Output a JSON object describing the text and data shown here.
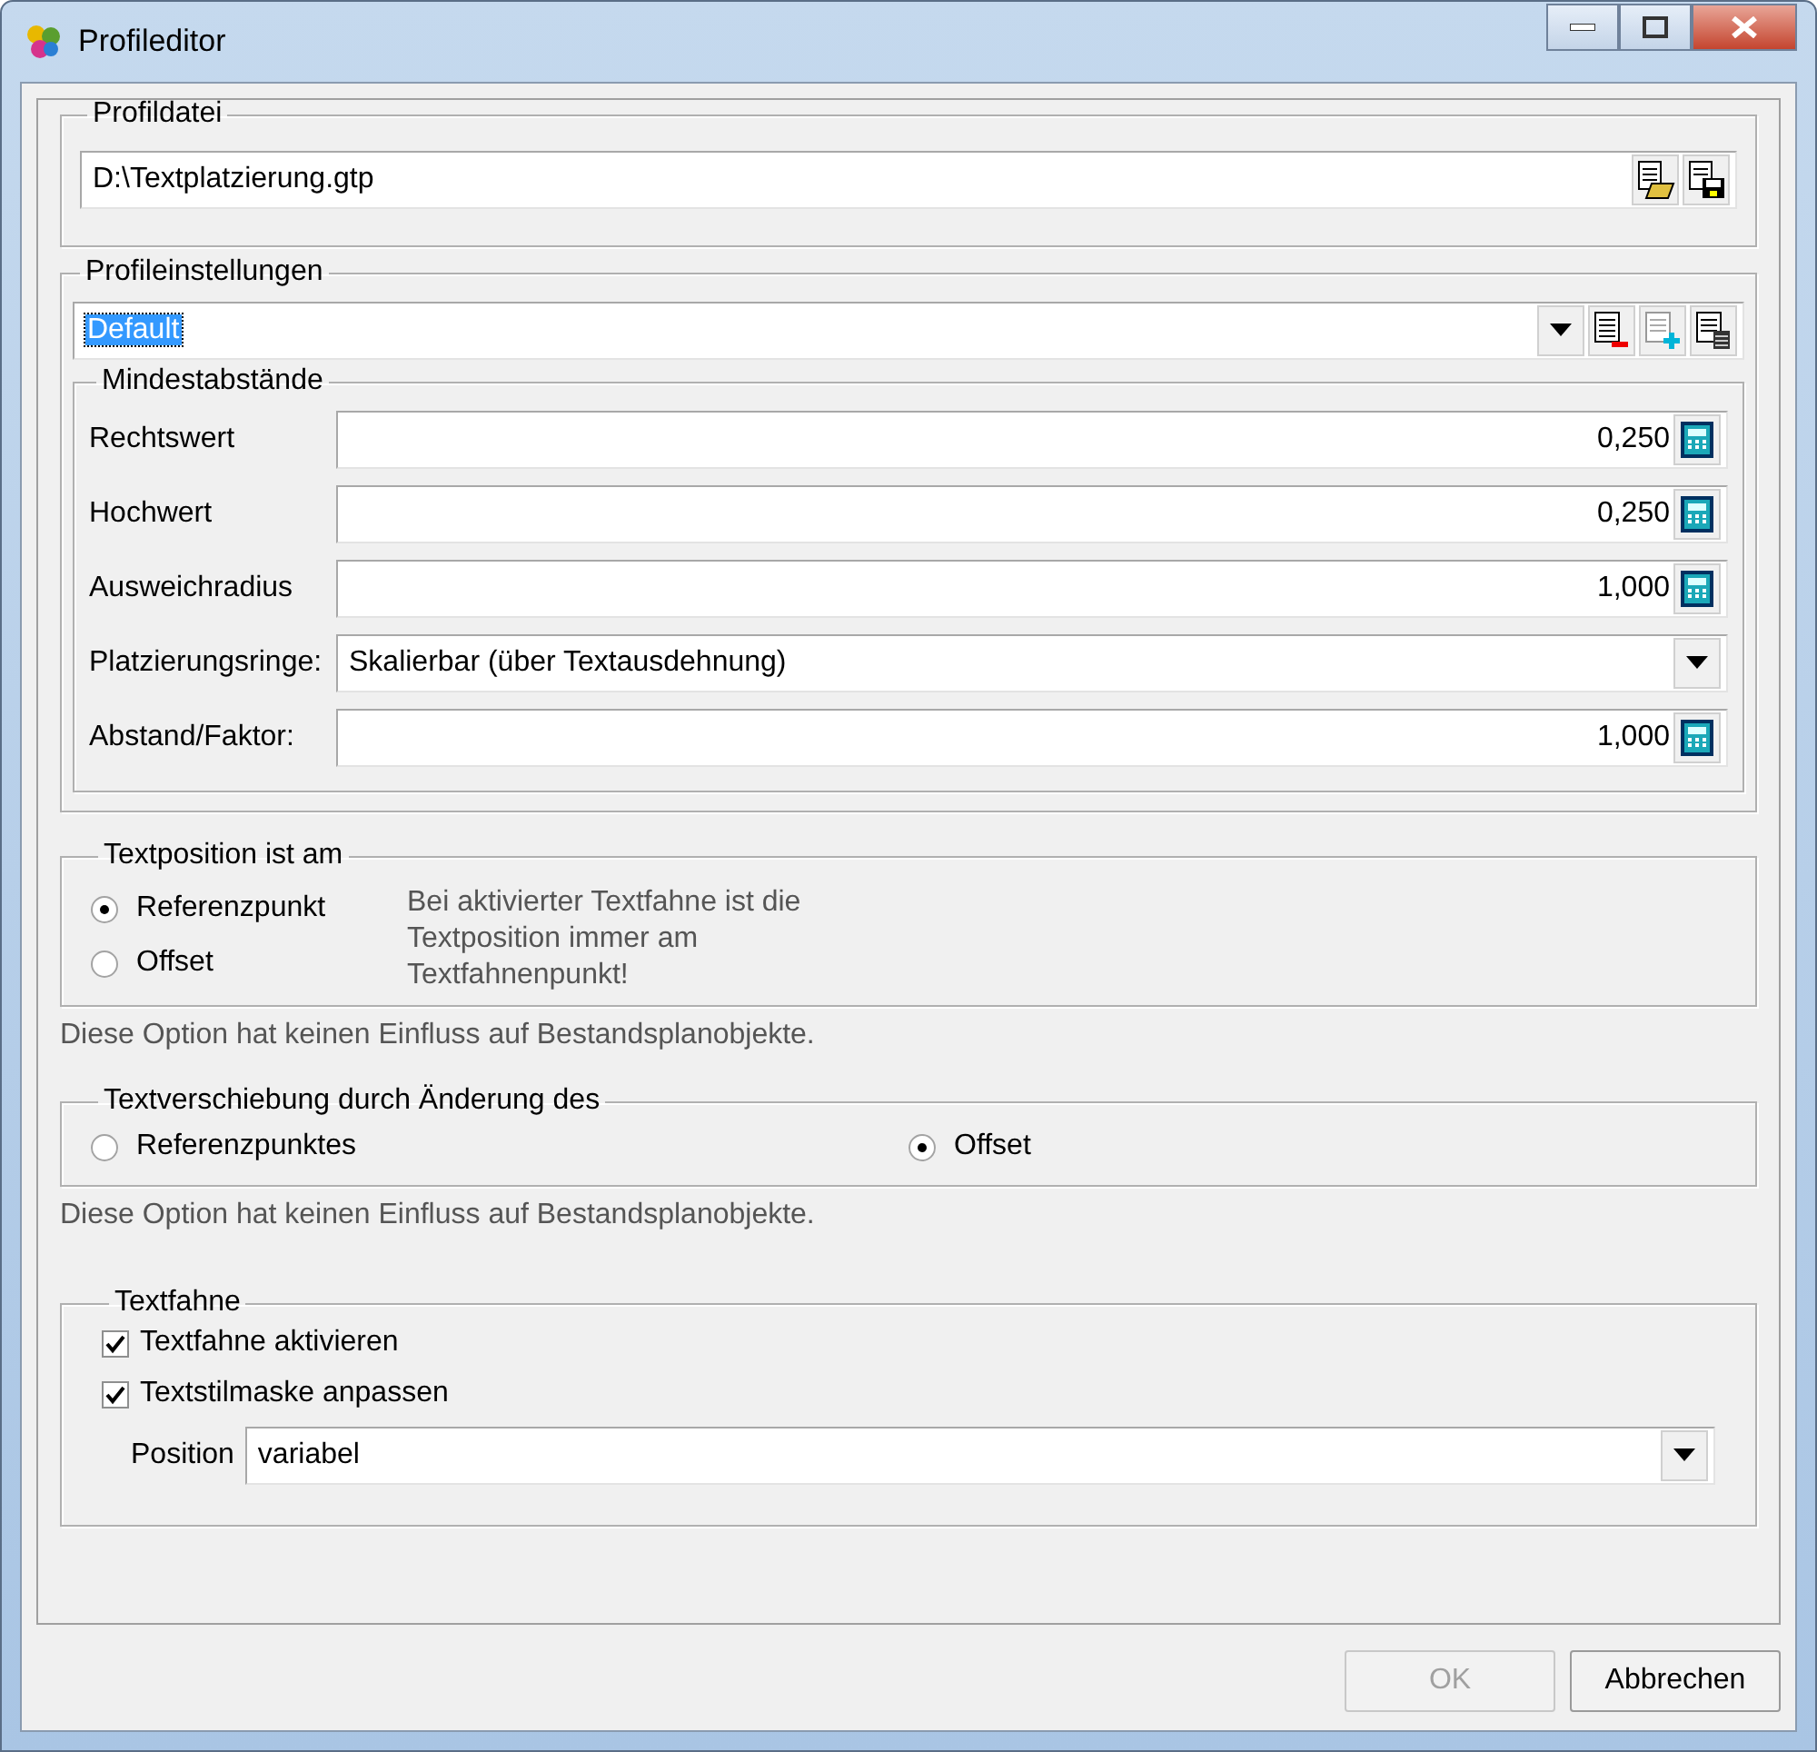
{
  "window": {
    "title": "Profileditor"
  },
  "profile_file": {
    "legend": "Profildatei",
    "value": "D:\\Textplatzierung.gtp"
  },
  "profile_settings": {
    "legend": "Profileinstellungen",
    "value": "Default",
    "min_distances": {
      "legend": "Mindestabstände",
      "fields": [
        {
          "kind": "number",
          "label": "Rechtswert",
          "value": "0,250"
        },
        {
          "kind": "number",
          "label": "Hochwert",
          "value": "0,250"
        },
        {
          "kind": "number",
          "label": "Ausweichradius",
          "value": "1,000"
        },
        {
          "kind": "dropdown",
          "label": "Platzierungsringe:",
          "value": "Skalierbar (über Textausdehnung)"
        },
        {
          "kind": "number",
          "label": "Abstand/Faktor:",
          "value": "1,000"
        }
      ]
    }
  },
  "text_position": {
    "legend": "Textposition ist am",
    "options": [
      {
        "label": "Referenzpunkt",
        "selected": true
      },
      {
        "label": "Offset",
        "selected": false
      }
    ],
    "note": "Bei aktivierter Textfahne ist die Textposition immer am Textfahnenpunkt!",
    "footnote": "Diese Option hat keinen Einfluss auf Bestandsplanobjekte."
  },
  "text_shift": {
    "legend": "Textverschiebung durch Änderung des",
    "options": [
      {
        "label": "Referenzpunktes",
        "selected": false
      },
      {
        "label": "Offset",
        "selected": true
      }
    ],
    "footnote": "Diese Option hat keinen Einfluss auf Bestandsplanobjekte."
  },
  "text_flag": {
    "legend": "Textfahne",
    "checkboxes": [
      {
        "label": "Textfahne aktivieren",
        "checked": true
      },
      {
        "label": "Textstilmaske anpassen",
        "checked": true
      }
    ],
    "position": {
      "label": "Position",
      "value": "variabel"
    }
  },
  "buttons": [
    {
      "label": "OK",
      "disabled": true
    },
    {
      "label": "Abbrechen",
      "disabled": false
    }
  ]
}
